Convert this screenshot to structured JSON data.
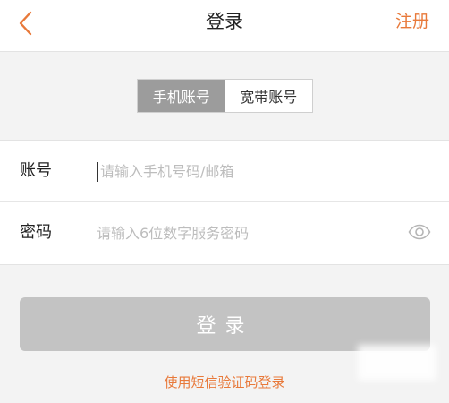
{
  "colors": {
    "accent": "#e8793a"
  },
  "header": {
    "back_icon": "chevron-left-icon",
    "title": "登录",
    "register_label": "注册"
  },
  "account_tabs": [
    {
      "label": "手机账号",
      "active": true
    },
    {
      "label": "宽带账号",
      "active": false
    }
  ],
  "form": {
    "account": {
      "label": "账号",
      "value": "",
      "placeholder": "请输入手机号码/邮箱"
    },
    "password": {
      "label": "密码",
      "value": "",
      "placeholder": "请输入6位数字服务密码",
      "visibility_icon": "eye-icon"
    }
  },
  "login_button": {
    "label": "登录"
  },
  "sms_login_link": "使用短信验证码登录"
}
